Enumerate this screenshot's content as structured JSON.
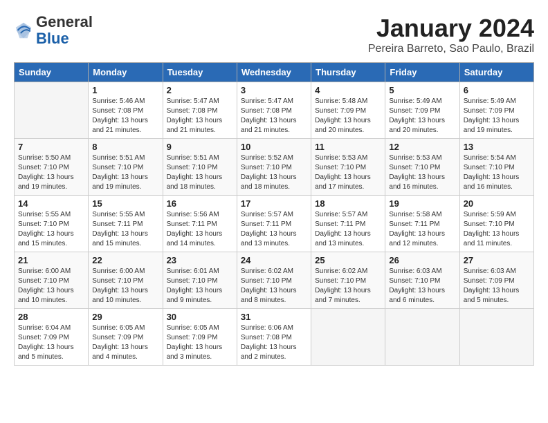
{
  "header": {
    "logo_general": "General",
    "logo_blue": "Blue",
    "month_year": "January 2024",
    "location": "Pereira Barreto, Sao Paulo, Brazil"
  },
  "days_of_week": [
    "Sunday",
    "Monday",
    "Tuesday",
    "Wednesday",
    "Thursday",
    "Friday",
    "Saturday"
  ],
  "weeks": [
    [
      {
        "day": "",
        "info": ""
      },
      {
        "day": "1",
        "info": "Sunrise: 5:46 AM\nSunset: 7:08 PM\nDaylight: 13 hours\nand 21 minutes."
      },
      {
        "day": "2",
        "info": "Sunrise: 5:47 AM\nSunset: 7:08 PM\nDaylight: 13 hours\nand 21 minutes."
      },
      {
        "day": "3",
        "info": "Sunrise: 5:47 AM\nSunset: 7:08 PM\nDaylight: 13 hours\nand 21 minutes."
      },
      {
        "day": "4",
        "info": "Sunrise: 5:48 AM\nSunset: 7:09 PM\nDaylight: 13 hours\nand 20 minutes."
      },
      {
        "day": "5",
        "info": "Sunrise: 5:49 AM\nSunset: 7:09 PM\nDaylight: 13 hours\nand 20 minutes."
      },
      {
        "day": "6",
        "info": "Sunrise: 5:49 AM\nSunset: 7:09 PM\nDaylight: 13 hours\nand 19 minutes."
      }
    ],
    [
      {
        "day": "7",
        "info": "Sunrise: 5:50 AM\nSunset: 7:10 PM\nDaylight: 13 hours\nand 19 minutes."
      },
      {
        "day": "8",
        "info": "Sunrise: 5:51 AM\nSunset: 7:10 PM\nDaylight: 13 hours\nand 19 minutes."
      },
      {
        "day": "9",
        "info": "Sunrise: 5:51 AM\nSunset: 7:10 PM\nDaylight: 13 hours\nand 18 minutes."
      },
      {
        "day": "10",
        "info": "Sunrise: 5:52 AM\nSunset: 7:10 PM\nDaylight: 13 hours\nand 18 minutes."
      },
      {
        "day": "11",
        "info": "Sunrise: 5:53 AM\nSunset: 7:10 PM\nDaylight: 13 hours\nand 17 minutes."
      },
      {
        "day": "12",
        "info": "Sunrise: 5:53 AM\nSunset: 7:10 PM\nDaylight: 13 hours\nand 16 minutes."
      },
      {
        "day": "13",
        "info": "Sunrise: 5:54 AM\nSunset: 7:10 PM\nDaylight: 13 hours\nand 16 minutes."
      }
    ],
    [
      {
        "day": "14",
        "info": "Sunrise: 5:55 AM\nSunset: 7:10 PM\nDaylight: 13 hours\nand 15 minutes."
      },
      {
        "day": "15",
        "info": "Sunrise: 5:55 AM\nSunset: 7:11 PM\nDaylight: 13 hours\nand 15 minutes."
      },
      {
        "day": "16",
        "info": "Sunrise: 5:56 AM\nSunset: 7:11 PM\nDaylight: 13 hours\nand 14 minutes."
      },
      {
        "day": "17",
        "info": "Sunrise: 5:57 AM\nSunset: 7:11 PM\nDaylight: 13 hours\nand 13 minutes."
      },
      {
        "day": "18",
        "info": "Sunrise: 5:57 AM\nSunset: 7:11 PM\nDaylight: 13 hours\nand 13 minutes."
      },
      {
        "day": "19",
        "info": "Sunrise: 5:58 AM\nSunset: 7:11 PM\nDaylight: 13 hours\nand 12 minutes."
      },
      {
        "day": "20",
        "info": "Sunrise: 5:59 AM\nSunset: 7:10 PM\nDaylight: 13 hours\nand 11 minutes."
      }
    ],
    [
      {
        "day": "21",
        "info": "Sunrise: 6:00 AM\nSunset: 7:10 PM\nDaylight: 13 hours\nand 10 minutes."
      },
      {
        "day": "22",
        "info": "Sunrise: 6:00 AM\nSunset: 7:10 PM\nDaylight: 13 hours\nand 10 minutes."
      },
      {
        "day": "23",
        "info": "Sunrise: 6:01 AM\nSunset: 7:10 PM\nDaylight: 13 hours\nand 9 minutes."
      },
      {
        "day": "24",
        "info": "Sunrise: 6:02 AM\nSunset: 7:10 PM\nDaylight: 13 hours\nand 8 minutes."
      },
      {
        "day": "25",
        "info": "Sunrise: 6:02 AM\nSunset: 7:10 PM\nDaylight: 13 hours\nand 7 minutes."
      },
      {
        "day": "26",
        "info": "Sunrise: 6:03 AM\nSunset: 7:10 PM\nDaylight: 13 hours\nand 6 minutes."
      },
      {
        "day": "27",
        "info": "Sunrise: 6:03 AM\nSunset: 7:09 PM\nDaylight: 13 hours\nand 5 minutes."
      }
    ],
    [
      {
        "day": "28",
        "info": "Sunrise: 6:04 AM\nSunset: 7:09 PM\nDaylight: 13 hours\nand 5 minutes."
      },
      {
        "day": "29",
        "info": "Sunrise: 6:05 AM\nSunset: 7:09 PM\nDaylight: 13 hours\nand 4 minutes."
      },
      {
        "day": "30",
        "info": "Sunrise: 6:05 AM\nSunset: 7:09 PM\nDaylight: 13 hours\nand 3 minutes."
      },
      {
        "day": "31",
        "info": "Sunrise: 6:06 AM\nSunset: 7:08 PM\nDaylight: 13 hours\nand 2 minutes."
      },
      {
        "day": "",
        "info": ""
      },
      {
        "day": "",
        "info": ""
      },
      {
        "day": "",
        "info": ""
      }
    ]
  ]
}
